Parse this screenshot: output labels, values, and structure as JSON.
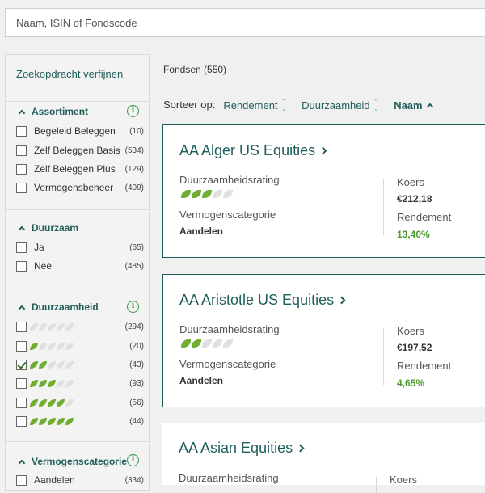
{
  "search": {
    "placeholder": "Naam, ISIN of Fondscode"
  },
  "sidebar": {
    "title": "Zoekopdracht verfijnen",
    "assortiment": {
      "heading": "Assortiment",
      "items": [
        {
          "label": "Begeleid Beleggen",
          "count": "(10)"
        },
        {
          "label": "Zelf Beleggen Basis",
          "count": "(534)"
        },
        {
          "label": "Zelf Beleggen Plus",
          "count": "(129)"
        },
        {
          "label": "Vermogensbeheer",
          "count": "(409)"
        }
      ]
    },
    "duurzaam": {
      "heading": "Duurzaam",
      "items": [
        {
          "label": "Ja",
          "count": "(65)"
        },
        {
          "label": "Nee",
          "count": "(485)"
        }
      ]
    },
    "duurzaamheid": {
      "heading": "Duurzaamheid",
      "items": [
        {
          "leaves": 0,
          "count": "(294)",
          "checked": false
        },
        {
          "leaves": 1,
          "count": "(20)",
          "checked": false
        },
        {
          "leaves": 2,
          "count": "(43)",
          "checked": true
        },
        {
          "leaves": 3,
          "count": "(93)",
          "checked": false
        },
        {
          "leaves": 4,
          "count": "(56)",
          "checked": false
        },
        {
          "leaves": 5,
          "count": "(44)",
          "checked": false
        }
      ]
    },
    "vermogenscategorie": {
      "heading": "Vermogenscategorie",
      "items": [
        {
          "label": "Aandelen",
          "count": "(334)"
        }
      ]
    }
  },
  "results": {
    "count_label": "Fondsen (550)",
    "sort": {
      "label": "Sorteer op:",
      "options": [
        "Rendement",
        "Duurzaamheid",
        "Naam"
      ],
      "active": "Naam"
    }
  },
  "funds": [
    {
      "name": "AA Alger US Equities",
      "rating_label": "Duurzaamheidsrating",
      "rating": 3,
      "category_label": "Vermogenscategorie",
      "category": "Aandelen",
      "koers_label": "Koers",
      "koers": "€212,18",
      "rendement_label": "Rendement",
      "rendement": "13,40%"
    },
    {
      "name": "AA Aristotle US Equities",
      "rating_label": "Duurzaamheidsrating",
      "rating": 2,
      "category_label": "Vermogenscategorie",
      "category": "Aandelen",
      "koers_label": "Koers",
      "koers": "€197,52",
      "rendement_label": "Rendement",
      "rendement": "4,65%"
    },
    {
      "name": "AA Asian Equities",
      "rating_label": "Duurzaamheidsrating",
      "koers_label": "Koers"
    }
  ],
  "colors": {
    "brand": "#1f5e5b",
    "leaf": "#6fae2f",
    "positive": "#4a9b2f"
  }
}
